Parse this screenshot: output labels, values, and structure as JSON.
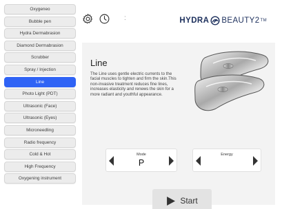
{
  "sidebar": {
    "items": [
      {
        "label": "Oxygeneo",
        "active": false
      },
      {
        "label": "Bubble pen",
        "active": false
      },
      {
        "label": "Hydra Dermabrasion",
        "active": false
      },
      {
        "label": "Diamond Dermabrasion",
        "active": false
      },
      {
        "label": "Scrubber",
        "active": false
      },
      {
        "label": "Spray / Injection",
        "active": false
      },
      {
        "label": "Line",
        "active": true
      },
      {
        "label": "Photo Light (PDT)",
        "active": false
      },
      {
        "label": "Ultrasonic (Face)",
        "active": false
      },
      {
        "label": "Ultrasonic (Eyes)",
        "active": false
      },
      {
        "label": "Microneedling",
        "active": false
      },
      {
        "label": "Radio frequency",
        "active": false
      },
      {
        "label": "Cold & Hot",
        "active": false
      },
      {
        "label": "High Frequency",
        "active": false
      },
      {
        "label": "Oxygening instrument",
        "active": false
      }
    ]
  },
  "header": {
    "settings_icon": "gear-icon",
    "history_icon": "clock-icon",
    "separator": ":",
    "brand_part1": "HYDRA",
    "brand_part2": "BEAUTY",
    "brand_suffix": "2",
    "brand_mark": "TM"
  },
  "main": {
    "title": "Line",
    "description": "The Line uses gentle electric currents to the facial muscles to tighten and firm the skin.This non-invasive treatment reduces fine lines, increases elasticity and renews the skin for a more radiant and youthful appearance.",
    "mode": {
      "label": "Mode",
      "value": "P"
    },
    "energy": {
      "label": "Energy",
      "value": ""
    },
    "start_label": "Start"
  },
  "colors": {
    "accent": "#2f63f5",
    "brand": "#1c2f5c",
    "panel_bg": "#f3f3f3",
    "button_bg": "#ececec"
  }
}
